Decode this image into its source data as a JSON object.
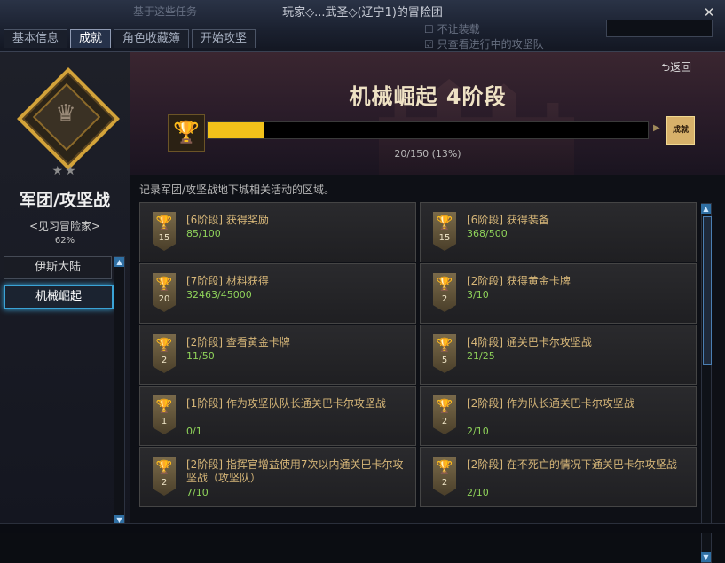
{
  "background": {
    "left_text": "基于这些任务",
    "options": [
      {
        "label": "不让装载"
      },
      {
        "label": "只查看进行中的攻坚队"
      }
    ]
  },
  "window": {
    "title": "玩家◇...武圣◇(辽宁1)的冒险团",
    "close_icon": "close-icon"
  },
  "tabs": [
    {
      "label": "基本信息",
      "active": false
    },
    {
      "label": "成就",
      "active": true
    },
    {
      "label": "角色收藏簿",
      "active": false
    },
    {
      "label": "开始攻坚",
      "active": false
    }
  ],
  "sidebar": {
    "stars": "★★",
    "category_title": "军团/攻坚战",
    "rank": "<见习冒险家>",
    "percent": "62%",
    "items": [
      {
        "label": "伊斯大陆",
        "active": false
      },
      {
        "label": "机械崛起",
        "active": true
      }
    ]
  },
  "header": {
    "back_label": "返回",
    "stage_title": "机械崛起 4阶段",
    "progress_text": "20/150 (13%)",
    "progress_fraction": 0.13,
    "reward_label": "成就"
  },
  "description": "记录军团/攻坚战地下城相关活动的区域。",
  "achievements": [
    {
      "title": "[6阶段] 获得奖励",
      "progress": "85/100",
      "trophy": "15"
    },
    {
      "title": "[6阶段] 获得装备",
      "progress": "368/500",
      "trophy": "15"
    },
    {
      "title": "[7阶段] 材料获得",
      "progress": "32463/45000",
      "trophy": "20"
    },
    {
      "title": "[2阶段] 获得黄金卡牌",
      "progress": "3/10",
      "trophy": "2"
    },
    {
      "title": "[2阶段] 查看黄金卡牌",
      "progress": "11/50",
      "trophy": "2"
    },
    {
      "title": "[4阶段] 通关巴卡尔攻坚战",
      "progress": "21/25",
      "trophy": "5"
    },
    {
      "title": "[1阶段] 作为攻坚队队长通关巴卡尔攻坚战",
      "progress": "0/1",
      "trophy": "1"
    },
    {
      "title": "[2阶段] 作为队长通关巴卡尔攻坚战",
      "progress": "2/10",
      "trophy": "2"
    },
    {
      "title": "[2阶段] 指挥官增益使用7次以内通关巴卡尔攻坚战（攻坚队）",
      "progress": "7/10",
      "trophy": "2"
    },
    {
      "title": "[2阶段] 在不死亡的情况下通关巴卡尔攻坚战",
      "progress": "2/10",
      "trophy": "2"
    }
  ]
}
